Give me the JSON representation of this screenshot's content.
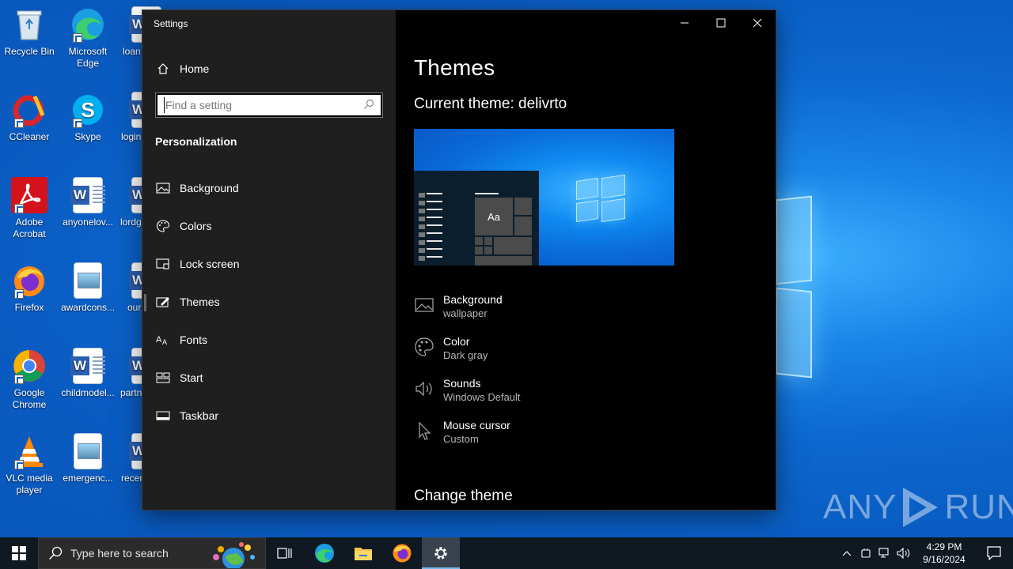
{
  "desktop": {
    "icons": [
      {
        "label": "Recycle Bin",
        "icon": "recycle-bin-icon"
      },
      {
        "label": "Microsoft Edge",
        "icon": "edge-icon"
      },
      {
        "label": "CCleaner",
        "icon": "ccleaner-icon"
      },
      {
        "label": "Skype",
        "icon": "skype-icon"
      },
      {
        "label": "Adobe Acrobat",
        "icon": "acrobat-icon"
      },
      {
        "label": "anyonelov...",
        "icon": "word-document-icon"
      },
      {
        "label": "Firefox",
        "icon": "firefox-icon"
      },
      {
        "label": "awardcons...",
        "icon": "image-document-icon"
      },
      {
        "label": "Google Chrome",
        "icon": "chrome-icon"
      },
      {
        "label": "childmodel...",
        "icon": "word-document-icon"
      },
      {
        "label": "VLC media player",
        "icon": "vlc-icon"
      },
      {
        "label": "emergenc...",
        "icon": "image-document-icon"
      },
      {
        "label": "loan",
        "icon": "word-document-icon"
      },
      {
        "label": "login",
        "icon": "word-document-icon"
      },
      {
        "label": "lordg",
        "icon": "word-document-icon"
      },
      {
        "label": "our",
        "icon": "word-document-icon"
      },
      {
        "label": "partn",
        "icon": "word-document-icon"
      },
      {
        "label": "recen",
        "icon": "word-document-icon"
      }
    ]
  },
  "settings": {
    "window_title": "Settings",
    "nav": {
      "home_label": "Home",
      "search_placeholder": "Find a setting",
      "section_title": "Personalization",
      "items": [
        {
          "label": "Background",
          "icon": "image-icon"
        },
        {
          "label": "Colors",
          "icon": "palette-icon"
        },
        {
          "label": "Lock screen",
          "icon": "lock-screen-icon"
        },
        {
          "label": "Themes",
          "icon": "themes-brush-icon",
          "selected": true
        },
        {
          "label": "Fonts",
          "icon": "fonts-icon"
        },
        {
          "label": "Start",
          "icon": "start-tiles-icon"
        },
        {
          "label": "Taskbar",
          "icon": "taskbar-icon"
        }
      ]
    },
    "content": {
      "page_title": "Themes",
      "current_theme": "Current theme: delivrto",
      "preview_tile_label": "Aa",
      "properties": [
        {
          "name": "Background",
          "value": "wallpaper",
          "icon": "image-icon"
        },
        {
          "name": "Color",
          "value": "Dark gray",
          "icon": "palette-icon"
        },
        {
          "name": "Sounds",
          "value": "Windows Default",
          "icon": "speaker-icon"
        },
        {
          "name": "Mouse cursor",
          "value": "Custom",
          "icon": "mouse-cursor-icon"
        }
      ],
      "change_theme_heading": "Change theme"
    }
  },
  "watermark": {
    "text_left": "ANY",
    "text_right": "RUN"
  },
  "taskbar": {
    "search_placeholder": "Type here to search",
    "pinned": [
      "task-view-icon",
      "edge-icon",
      "file-explorer-icon",
      "firefox-icon",
      "settings-gear-icon"
    ],
    "clock_time": "4:29 PM",
    "clock_date": "9/16/2024"
  },
  "colors": {
    "nav_background": "#1f1f1f",
    "content_background": "#000000",
    "taskbar_background": "#101821",
    "accent": "#0a78d7"
  }
}
